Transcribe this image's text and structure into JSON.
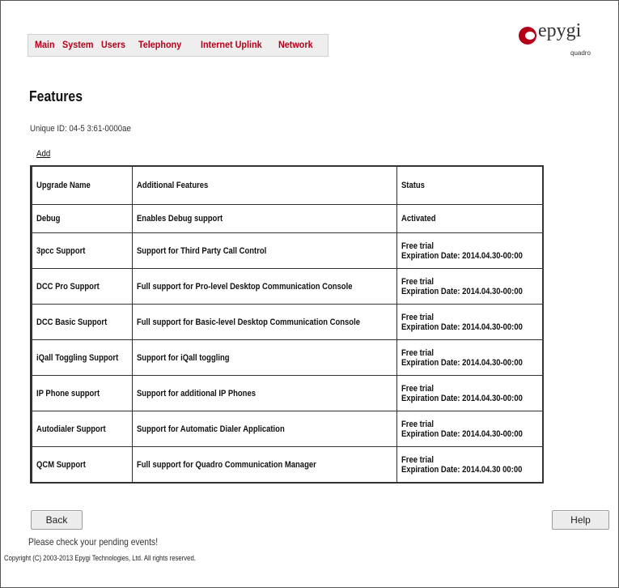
{
  "nav": {
    "items": [
      "Main",
      "System",
      "Users",
      "Telephony",
      "Internet Uplink",
      "Network"
    ]
  },
  "logo": {
    "word": "epygi",
    "sub": "quadro"
  },
  "page": {
    "title": "Features",
    "unique_id": "Unique ID: 04-5 3:61-0000ae",
    "add_label": "Add"
  },
  "table": {
    "headers": [
      "Upgrade Name",
      "Additional Features",
      "Status"
    ],
    "rows": [
      {
        "name": "Debug",
        "features": "Enables Debug support",
        "status": [
          "Activated"
        ]
      },
      {
        "name": "3pcc Support",
        "features": "Support for Third Party Call Control",
        "status": [
          "Free trial",
          "Expiration Date: 2014.04.30-00:00"
        ]
      },
      {
        "name": "DCC Pro Support",
        "features": "Full support for Pro-level Desktop Communication Console",
        "status": [
          "Free trial",
          "Expiration Date: 2014.04.30-00:00"
        ]
      },
      {
        "name": "DCC Basic Support",
        "features": "Full support for Basic-level Desktop Communication Console",
        "status": [
          "Free trial",
          "Expiration Date: 2014.04.30-00:00"
        ]
      },
      {
        "name": "iQall Toggling Support",
        "features": "Support for iQall toggling",
        "status": [
          "Free trial",
          "Expiration Date: 2014.04.30-00:00"
        ]
      },
      {
        "name": "IP Phone support",
        "features": "Support for additional IP Phones",
        "status": [
          "Free trial",
          "Expiration Date: 2014.04.30-00:00"
        ]
      },
      {
        "name": "Autodialer Support",
        "features": "Support for Automatic Dialer Application",
        "status": [
          "Free trial",
          "Expiration Date: 2014.04.30-00:00"
        ]
      },
      {
        "name": "QCM Support",
        "features": "Full support for Quadro Communication Manager",
        "status": [
          "Free trial",
          "Expiration Date: 2014.04.30 00:00"
        ]
      }
    ]
  },
  "buttons": {
    "back": "Back",
    "help": "Help"
  },
  "footer": {
    "pending": "Please check your pending events!",
    "copyright": "Copyright (C) 2003-2013 Epygi Technologies, Ltd. All rights reserved."
  },
  "colors": {
    "nav_text": "#b5001a",
    "brand": "#b5001a"
  }
}
